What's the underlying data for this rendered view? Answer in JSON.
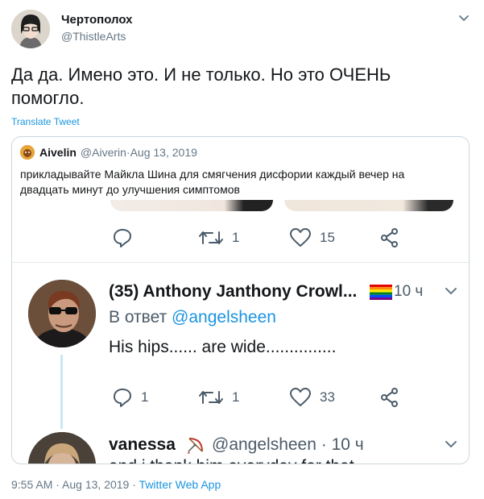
{
  "tweet": {
    "author_name": "Чертополох",
    "author_handle": "@ThistleArts",
    "text": "Да да. Имено это. И не только. Но это ОЧЕНЬ помогло.",
    "translate_label": "Translate Tweet",
    "time": "9:55 AM",
    "separator": " · ",
    "date": "Aug 13, 2019",
    "source": "Twitter Web App"
  },
  "quote": {
    "author_name": "Aivelin",
    "author_handle": "@Aiverin",
    "meta_sep": " · ",
    "date": "Aug 13, 2019",
    "text": "прикладывайте Майкла Шина для смягчения дисфории каждый вечер на двадцать минут до улучшения симптомов",
    "screenshot": {
      "actions": {
        "reply_count": "",
        "retweet_count": "1",
        "like_count": "15"
      },
      "reply": {
        "author_name": "(35) Anthony Janthony Crowl...",
        "time": "10 ч",
        "reply_prefix": "В ответ ",
        "reply_to": "@angelsheen",
        "text": "His hips...... are wide...............",
        "actions": {
          "reply_count": "1",
          "retweet_count": "1",
          "like_count": "33"
        }
      },
      "next": {
        "author_name": "vanessa",
        "author_handle": "@angelsheen · 10 ч",
        "text": "and i thank him everyday for that"
      }
    }
  },
  "colors": {
    "accent": "#1b95e0",
    "muted": "#657786",
    "border": "#ccd6dd",
    "thread": "#c9e7f5"
  },
  "icons": [
    "chevron-down-icon",
    "reply-icon",
    "retweet-icon",
    "like-icon",
    "share-icon",
    "rainbow-flag-icon",
    "bow-arrow-icon"
  ]
}
